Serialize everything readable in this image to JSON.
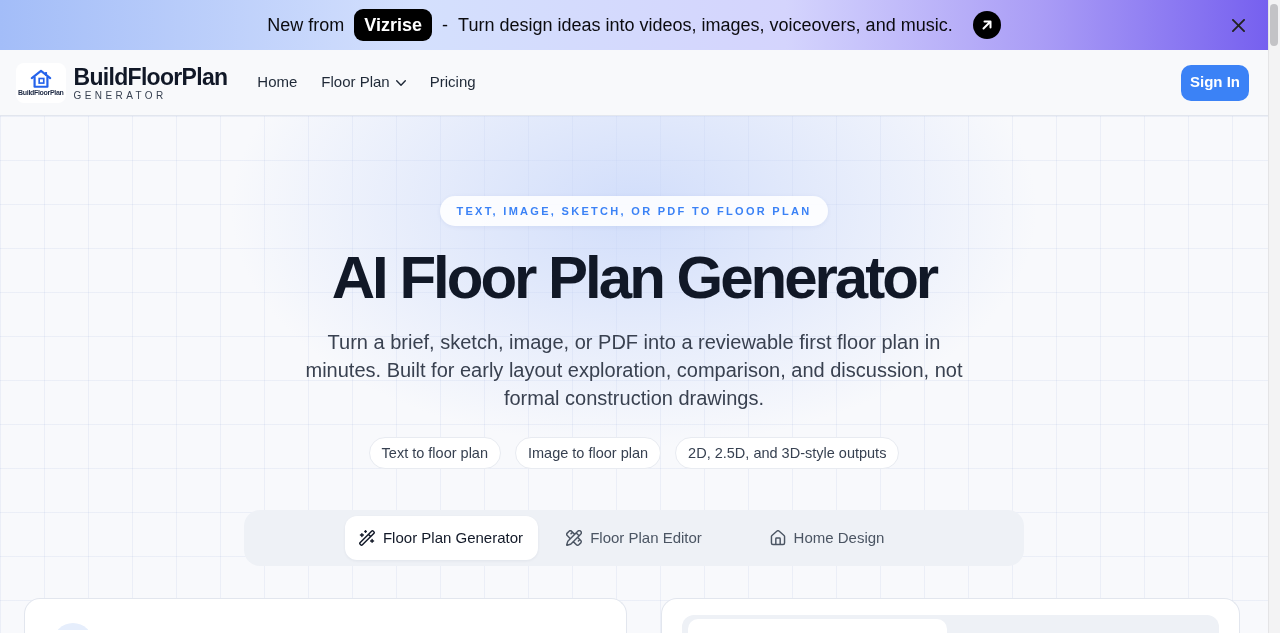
{
  "announcement": {
    "prefix": "New from",
    "brand": "Vizrise",
    "separator": "-",
    "message": "Turn design ideas into videos, images, voiceovers, and music."
  },
  "navbar": {
    "logo_caption": "BuildFloorPlan",
    "brand": "BuildFloorPlan",
    "tagline": "GENERATOR",
    "links": [
      {
        "label": "Home",
        "kind": "link"
      },
      {
        "label": "Floor Plan",
        "kind": "dropdown"
      },
      {
        "label": "Pricing",
        "kind": "link"
      }
    ],
    "sign_in": "Sign In"
  },
  "hero": {
    "eyebrow": "TEXT, IMAGE, SKETCH, OR PDF TO FLOOR PLAN",
    "title": "AI Floor Plan Generator",
    "subtitle": "Turn a brief, sketch, image, or PDF into a reviewable first floor plan in minutes. Built for early layout exploration, comparison, and discussion, not formal construction drawings.",
    "chips": [
      "Text to floor plan",
      "Image to floor plan",
      "2D, 2.5D, and 3D-style outputs"
    ]
  },
  "tabs": [
    {
      "label": "Floor Plan Generator",
      "selected": true
    },
    {
      "label": "Floor Plan Editor",
      "selected": false
    },
    {
      "label": "Home Design",
      "selected": false
    }
  ]
}
